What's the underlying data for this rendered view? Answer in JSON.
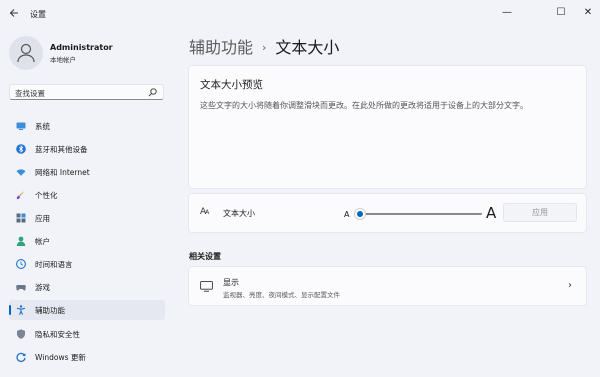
{
  "window": {
    "title": "设置",
    "back_icon": "back-arrow-icon",
    "minimize": "—",
    "maximize": "☐",
    "close": "✕"
  },
  "user": {
    "name": "Administrator",
    "account_type": "本地帐户"
  },
  "search": {
    "placeholder": "查找设置"
  },
  "sidebar": {
    "items": [
      {
        "label": "系统",
        "icon": "monitor-icon"
      },
      {
        "label": "蓝牙和其他设备",
        "icon": "bluetooth-icon"
      },
      {
        "label": "网络和 Internet",
        "icon": "wifi-icon"
      },
      {
        "label": "个性化",
        "icon": "brush-icon"
      },
      {
        "label": "应用",
        "icon": "apps-icon"
      },
      {
        "label": "帐户",
        "icon": "person-icon"
      },
      {
        "label": "时间和语言",
        "icon": "globe-clock-icon"
      },
      {
        "label": "游戏",
        "icon": "gamepad-icon"
      },
      {
        "label": "辅助功能",
        "icon": "accessibility-icon",
        "selected": true
      },
      {
        "label": "隐私和安全性",
        "icon": "shield-icon"
      },
      {
        "label": "Windows 更新",
        "icon": "windows-update-icon"
      }
    ]
  },
  "header": {
    "parent": "辅助功能",
    "separator": "›",
    "current": "文本大小"
  },
  "preview": {
    "title": "文本大小预览",
    "text": "这些文字的大小将随着你调整滑块而更改。在此处所做的更改将适用于设备上的大部分文字。"
  },
  "text_size": {
    "label": "文本大小",
    "icon_big": "A",
    "icon_small": "A",
    "slider_min_label": "A",
    "slider_max_label": "A",
    "slider_value_fraction": 0.0,
    "apply_label": "应用"
  },
  "related": {
    "heading": "相关设置",
    "display": {
      "title": "显示",
      "subtitle": "监视器、亮度、夜间模式、显示配置文件",
      "chevron": "›"
    }
  },
  "colors": {
    "accent": "#0067c0",
    "background": "#f1f3f9",
    "card": "#fbfbfd"
  }
}
